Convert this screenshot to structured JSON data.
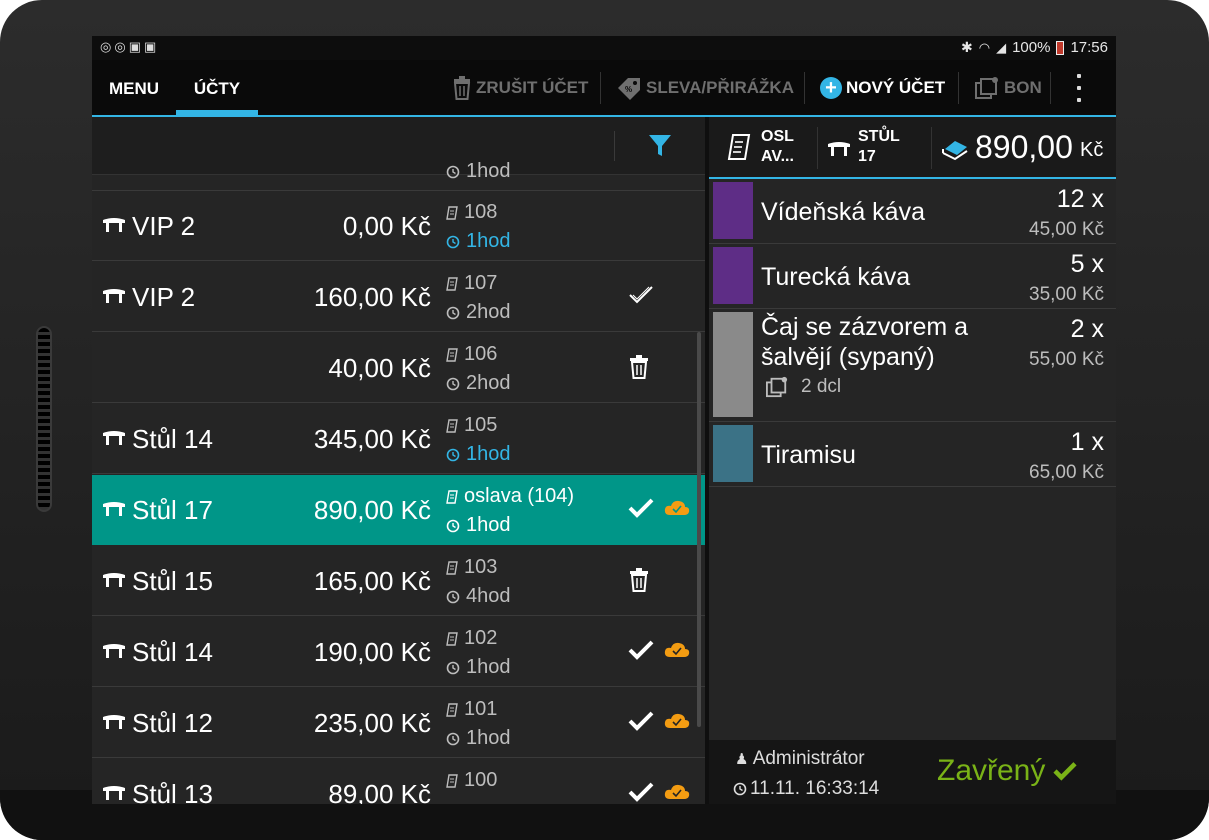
{
  "colors": {
    "accent": "#33b5e5",
    "selected_row": "#009688",
    "cloud": "#f39c12",
    "closed_green": "#7ab317"
  },
  "status_bar": {
    "left_icons": [
      "notification-icon",
      "notification-icon",
      "shop-icon",
      "shop-icon"
    ],
    "battery": "100%",
    "time": "17:56"
  },
  "action_bar": {
    "tabs": [
      {
        "label": "MENU",
        "active": false
      },
      {
        "label": "ÚČTY",
        "active": true
      }
    ],
    "actions": [
      {
        "label": "ZRUŠIT ÚČET",
        "icon": "trash-icon",
        "enabled": false
      },
      {
        "label": "SLEVA/PŘIRÁŽKA",
        "icon": "discount-tag-icon",
        "enabled": false
      },
      {
        "label": "NOVÝ ÚČET",
        "icon": "plus-circle-icon",
        "enabled": true
      },
      {
        "label": "BON",
        "icon": "bon-icon",
        "enabled": false
      }
    ]
  },
  "accounts": {
    "partial_top": {
      "duration": "1hod"
    },
    "rows": [
      {
        "table": "VIP 2",
        "amount": "0,00 Kč",
        "bill": "108",
        "duration": "1hod",
        "duration_highlight": true,
        "status": "",
        "cloud": false,
        "selected": false
      },
      {
        "table": "VIP 2",
        "amount": "160,00 Kč",
        "bill": "107",
        "duration": "2hod",
        "duration_highlight": false,
        "status": "check-outline",
        "cloud": false,
        "selected": false
      },
      {
        "table": "",
        "amount": "40,00 Kč",
        "bill": "106",
        "duration": "2hod",
        "duration_highlight": false,
        "status": "trash",
        "cloud": false,
        "selected": false
      },
      {
        "table": "Stůl 14",
        "amount": "345,00 Kč",
        "bill": "105",
        "duration": "1hod",
        "duration_highlight": true,
        "status": "",
        "cloud": false,
        "selected": false
      },
      {
        "table": "Stůl 17",
        "amount": "890,00 Kč",
        "bill": "oslava (104)",
        "duration": "1hod",
        "duration_highlight": false,
        "status": "check",
        "cloud": true,
        "selected": true
      },
      {
        "table": "Stůl 15",
        "amount": "165,00 Kč",
        "bill": "103",
        "duration": "4hod",
        "duration_highlight": false,
        "status": "trash",
        "cloud": false,
        "selected": false
      },
      {
        "table": "Stůl 14",
        "amount": "190,00 Kč",
        "bill": "102",
        "duration": "1hod",
        "duration_highlight": false,
        "status": "check",
        "cloud": true,
        "selected": false
      },
      {
        "table": "Stůl 12",
        "amount": "235,00 Kč",
        "bill": "101",
        "duration": "1hod",
        "duration_highlight": false,
        "status": "check",
        "cloud": true,
        "selected": false
      },
      {
        "table": "Stůl 13",
        "amount": "89,00 Kč",
        "bill": "100",
        "duration": "",
        "duration_highlight": false,
        "status": "check",
        "cloud": true,
        "selected": false
      }
    ]
  },
  "detail": {
    "bill_label": "OSL AV...",
    "table_label": "STŮL 17",
    "total": "890,00",
    "currency": "Kč",
    "items": [
      {
        "name": "Vídeňská káva",
        "qty": "12 x",
        "price": "45,00 Kč",
        "color": "#5e2d86",
        "note": ""
      },
      {
        "name": "Turecká káva",
        "qty": "5 x",
        "price": "35,00 Kč",
        "color": "#5e2d86",
        "note": ""
      },
      {
        "name": "Čaj se zázvorem a šalvějí (sypaný)",
        "qty": "2 x",
        "price": "55,00 Kč",
        "color": "#8a8a8a",
        "note": "2 dcl"
      },
      {
        "name": "Tiramisu",
        "qty": "1 x",
        "price": "65,00 Kč",
        "color": "#3b7286",
        "note": ""
      }
    ],
    "footer": {
      "user": "Administrátor",
      "timestamp": "11.11. 16:33:14",
      "state": "Zavřený"
    }
  }
}
